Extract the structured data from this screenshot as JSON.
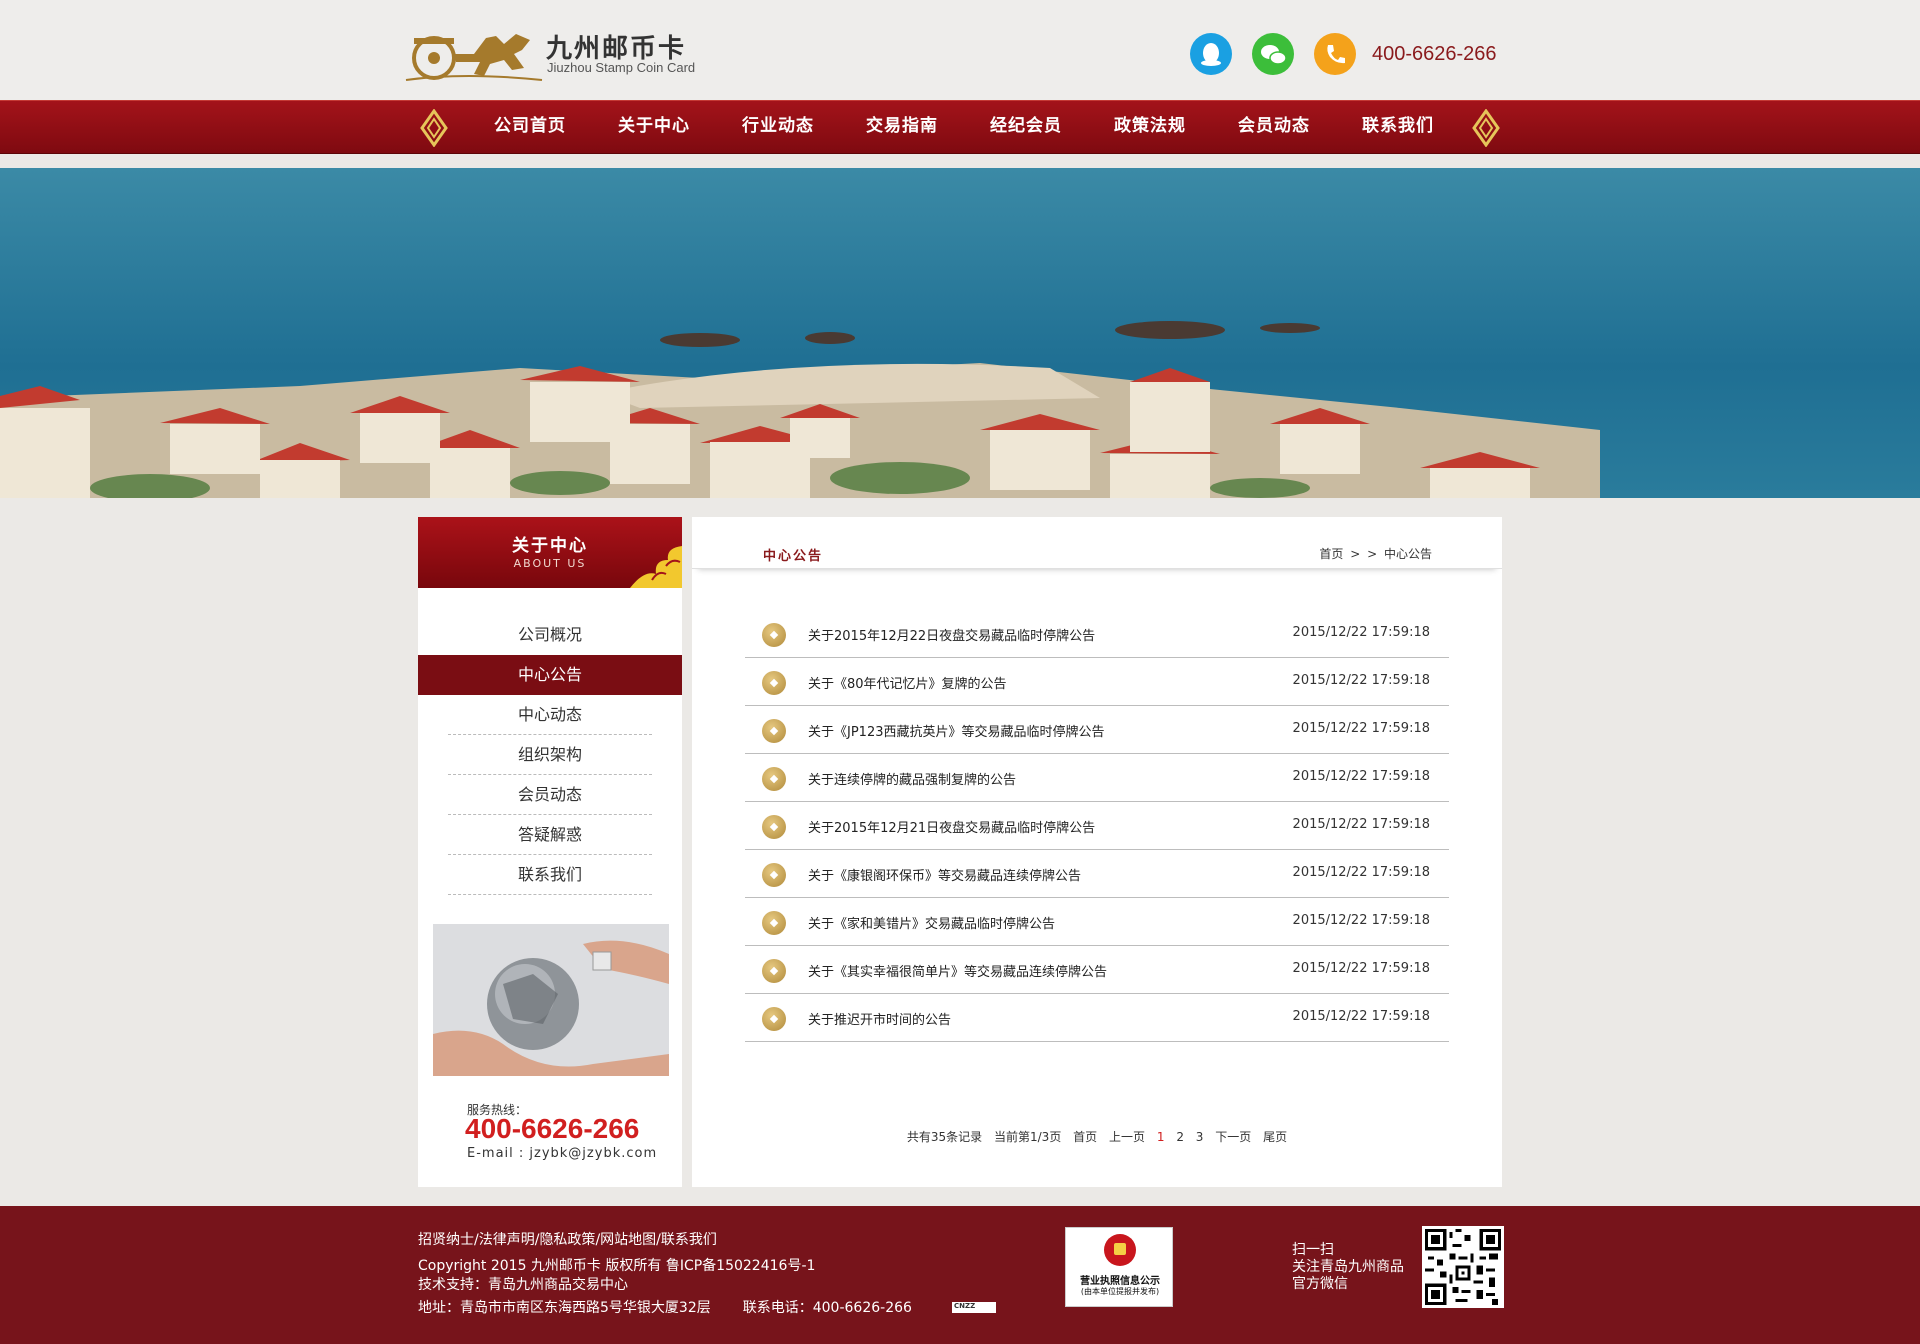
{
  "header": {
    "logo_cn": "九州邮币卡",
    "logo_en": "Jiuzhou Stamp Coin Card",
    "icons": [
      "qq-icon",
      "wechat-icon",
      "phone-icon"
    ],
    "phone": "400-6626-266"
  },
  "nav": {
    "items": [
      "公司首页",
      "关于中心",
      "行业动态",
      "交易指南",
      "经纪会员",
      "政策法规",
      "会员动态",
      "联系我们"
    ]
  },
  "sidebar": {
    "title_cn": "关于中心",
    "title_en": "ABOUT US",
    "items": [
      "公司概况",
      "中心公告",
      "中心动态",
      "组织架构",
      "会员动态",
      "答疑解惑",
      "联系我们"
    ],
    "active_index": 1,
    "hotline_label": "服务热线：",
    "hotline": "400-6626-266",
    "email": "E-mail : jzybk@jzybk.com"
  },
  "content": {
    "title": "中心公告",
    "breadcrumb": {
      "home": "首页",
      "sep1": ">",
      "sep2": ">",
      "current": "中心公告"
    },
    "news": [
      {
        "title": "关于2015年12月22日夜盘交易藏品临时停牌公告",
        "date": "2015/12/22 17:59:18"
      },
      {
        "title": "关于《80年代记忆片》复牌的公告",
        "date": "2015/12/22 17:59:18"
      },
      {
        "title": "关于《JP123西藏抗英片》等交易藏品临时停牌公告",
        "date": "2015/12/22 17:59:18"
      },
      {
        "title": "关于连续停牌的藏品强制复牌的公告",
        "date": "2015/12/22 17:59:18"
      },
      {
        "title": "关于2015年12月21日夜盘交易藏品临时停牌公告",
        "date": "2015/12/22 17:59:18"
      },
      {
        "title": "关于《康银阁环保币》等交易藏品连续停牌公告",
        "date": "2015/12/22 17:59:18"
      },
      {
        "title": "关于《家和美错片》交易藏品临时停牌公告",
        "date": "2015/12/22 17:59:18"
      },
      {
        "title": "关于《其实幸福很简单片》等交易藏品连续停牌公告",
        "date": "2015/12/22 17:59:18"
      },
      {
        "title": "关于推迟开市时间的公告",
        "date": "2015/12/22 17:59:18"
      }
    ],
    "pager": {
      "total": "共有35条记录",
      "current": "当前第1/3页",
      "first": "首页",
      "prev": "上一页",
      "pages": [
        "1",
        "2",
        "3"
      ],
      "next": "下一页",
      "last": "尾页"
    }
  },
  "footer": {
    "links": [
      "招贤纳士",
      "法律声明",
      "隐私政策",
      "网站地图",
      "联系我们"
    ],
    "link_sep": "/",
    "copyright": "Copyright 2015 九州邮币卡 版权所有  鲁ICP备15022416号-1",
    "support": "技术支持：青岛九州商品交易中心",
    "address": "地址：青岛市市南区东海西路5号华银大厦32层",
    "tel": "联系电话：400-6626-266",
    "cnzz": "CNZZ",
    "license_title": "营业执照信息公示",
    "license_sub": "(由本单位提报并发布)",
    "scan_lines": [
      "扫一扫",
      "关注青岛九州商品",
      "官方微信"
    ]
  },
  "colors": {
    "brand_red": "#8a1a1c",
    "nav_red": "#a3131a",
    "footer_red": "#77141b",
    "accent_red": "#d11f1f",
    "gold": "#b08a3a"
  }
}
